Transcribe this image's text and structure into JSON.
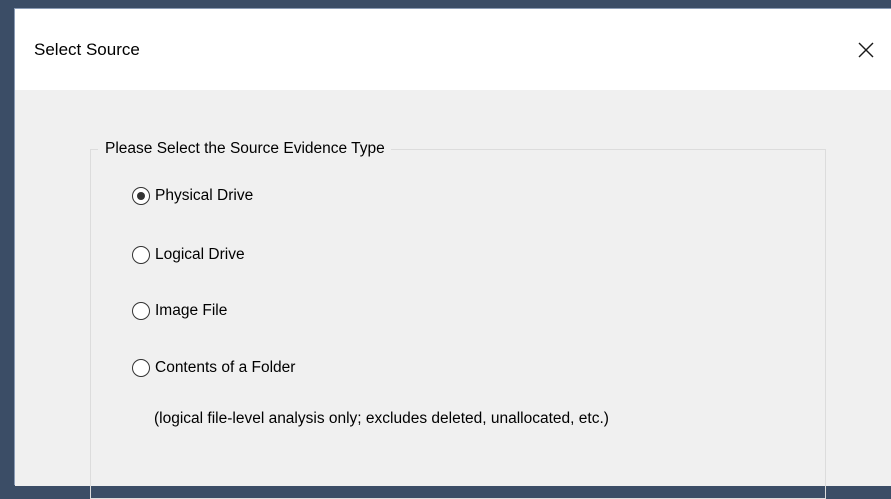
{
  "dialog": {
    "title": "Select Source",
    "close_icon": "close-icon"
  },
  "group": {
    "legend": "Please Select the Source Evidence Type"
  },
  "options": [
    {
      "label": "Physical Drive",
      "checked": true
    },
    {
      "label": "Logical Drive",
      "checked": false
    },
    {
      "label": "Image File",
      "checked": false
    },
    {
      "label": "Contents of a Folder",
      "checked": false
    }
  ],
  "folder_note": "(logical file-level analysis only; excludes deleted, unallocated, etc.)"
}
